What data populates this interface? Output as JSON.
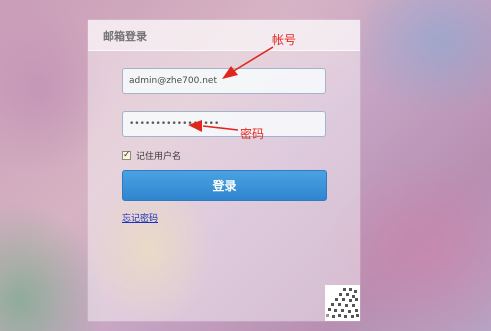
{
  "panel": {
    "title": "邮箱登录",
    "account_value": "admin@zhe700.net",
    "password_value": "•••••••••••••••••",
    "remember_label": "记住用户名",
    "remember_checked": true,
    "login_label": "登录",
    "forgot_label": "忘记密码"
  },
  "annotations": {
    "account": "帐号",
    "password": "密码",
    "color": "#e0261d"
  },
  "colors": {
    "button": "#3a93d8",
    "link": "#1b2fb8"
  },
  "icons": {
    "checkbox": "check-icon",
    "qr": "qr-code-icon"
  }
}
